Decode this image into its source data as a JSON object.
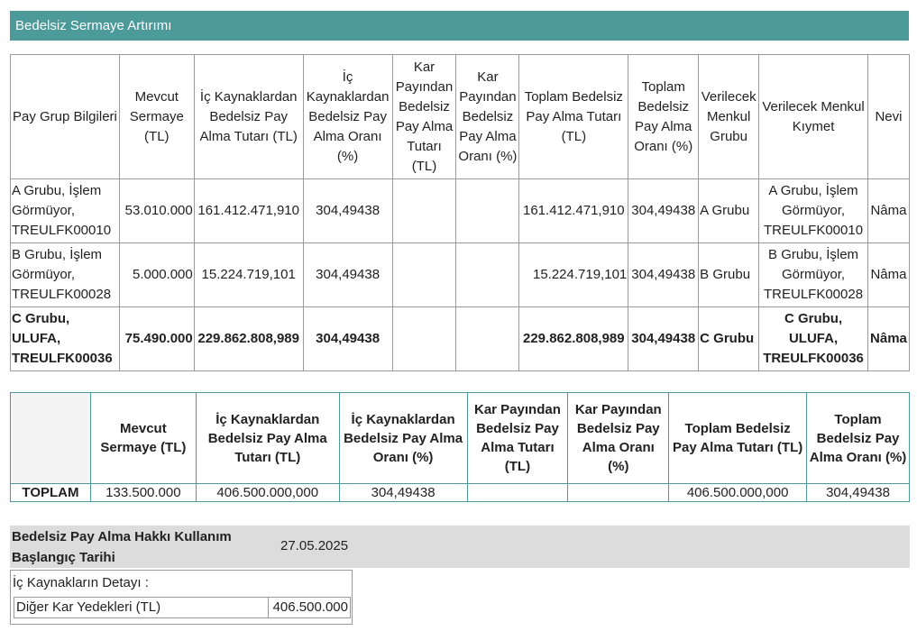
{
  "title": "Bedelsiz Sermaye Artırımı",
  "group_table": {
    "headers": [
      "Pay Grup Bilgileri",
      "Mevcut Sermaye (TL)",
      "İç Kaynaklardan Bedelsiz Pay Alma Tutarı (TL)",
      "İç Kaynaklardan Bedelsiz Pay Alma Oranı (%)",
      "Kar Payından Bedelsiz Pay Alma Tutarı (TL)",
      "Kar Payından Bedelsiz Pay Alma Oranı (%)",
      "Toplam Bedelsiz Pay Alma Tutarı (TL)",
      "Toplam Bedelsiz Pay Alma Oranı (%)",
      "Verilecek Menkul Grubu",
      "Verilecek Menkul Kıymet",
      "Nevi"
    ],
    "rows": [
      [
        "A Grubu, İşlem Görmüyor, TREULFK00010",
        "53.010.000",
        "161.412.471,910",
        "304,49438",
        "",
        "",
        "161.412.471,910",
        "304,49438",
        "A Grubu",
        "A Grubu, İşlem Görmüyor, TREULFK00010",
        "Nâma"
      ],
      [
        "B Grubu, İşlem Görmüyor, TREULFK00028",
        "5.000.000",
        "15.224.719,101",
        "304,49438",
        "",
        "",
        "15.224.719,101",
        "304,49438",
        "B Grubu",
        "B Grubu, İşlem Görmüyor, TREULFK00028",
        "Nâma"
      ],
      [
        "C Grubu, ULUFA, TREULFK00036",
        "75.490.000",
        "229.862.808,989",
        "304,49438",
        "",
        "",
        "229.862.808,989",
        "304,49438",
        "C Grubu",
        "C Grubu, ULUFA, TREULFK00036",
        "Nâma"
      ]
    ]
  },
  "total_table": {
    "headers": [
      "",
      "Mevcut Sermaye (TL)",
      "İç Kaynaklardan Bedelsiz Pay Alma Tutarı (TL)",
      "İç Kaynaklardan Bedelsiz Pay Alma Oranı (%)",
      "Kar Payından Bedelsiz Pay Alma Tutarı (TL)",
      "Kar Payından Bedelsiz Pay Alma Oranı (%)",
      "Toplam Bedelsiz Pay Alma Tutarı (TL)",
      "Toplam Bedelsiz Pay Alma Oranı (%)"
    ],
    "row": [
      "TOPLAM",
      "133.500.000",
      "406.500.000,000",
      "304,49438",
      "",
      "",
      "406.500.000,000",
      "304,49438"
    ]
  },
  "start_date": {
    "label": "Bedelsiz Pay Alma Hakkı Kullanım Başlangıç Tarihi",
    "value": "27.05.2025"
  },
  "detail": {
    "title": "İç Kaynakların Detayı :",
    "rows": [
      [
        "Diğer Kar Yedekleri (TL)",
        "406.500.000"
      ]
    ]
  }
}
